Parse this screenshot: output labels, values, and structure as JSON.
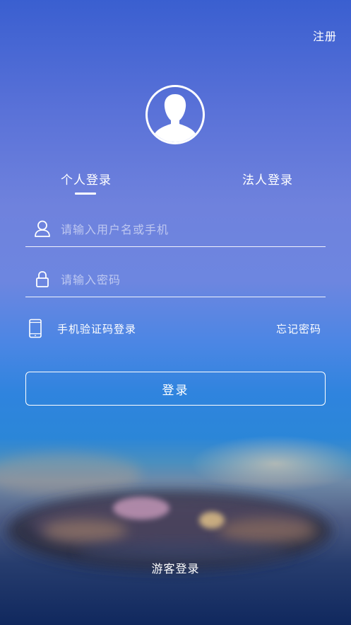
{
  "header": {
    "register_label": "注册"
  },
  "avatar": {
    "icon": "user-avatar-icon"
  },
  "tabs": [
    {
      "label": "个人登录",
      "active": true
    },
    {
      "label": "法人登录",
      "active": false
    }
  ],
  "form": {
    "username": {
      "placeholder": "请输入用户名或手机",
      "value": "",
      "icon": "user-icon"
    },
    "password": {
      "placeholder": "请输入密码",
      "value": "",
      "icon": "lock-icon"
    }
  },
  "options": {
    "sms_login_label": "手机验证码登录",
    "sms_icon": "phone-icon",
    "forgot_password_label": "忘记密码"
  },
  "login_button_label": "登录",
  "guest_login_label": "游客登录",
  "colors": {
    "background_top": "#3a5fd0",
    "background_mid": "#6d86e0",
    "background_blue": "#2f84de",
    "background_bottom": "#10285e",
    "text": "#ffffff",
    "placeholder": "rgba(255,255,255,0.55)"
  }
}
